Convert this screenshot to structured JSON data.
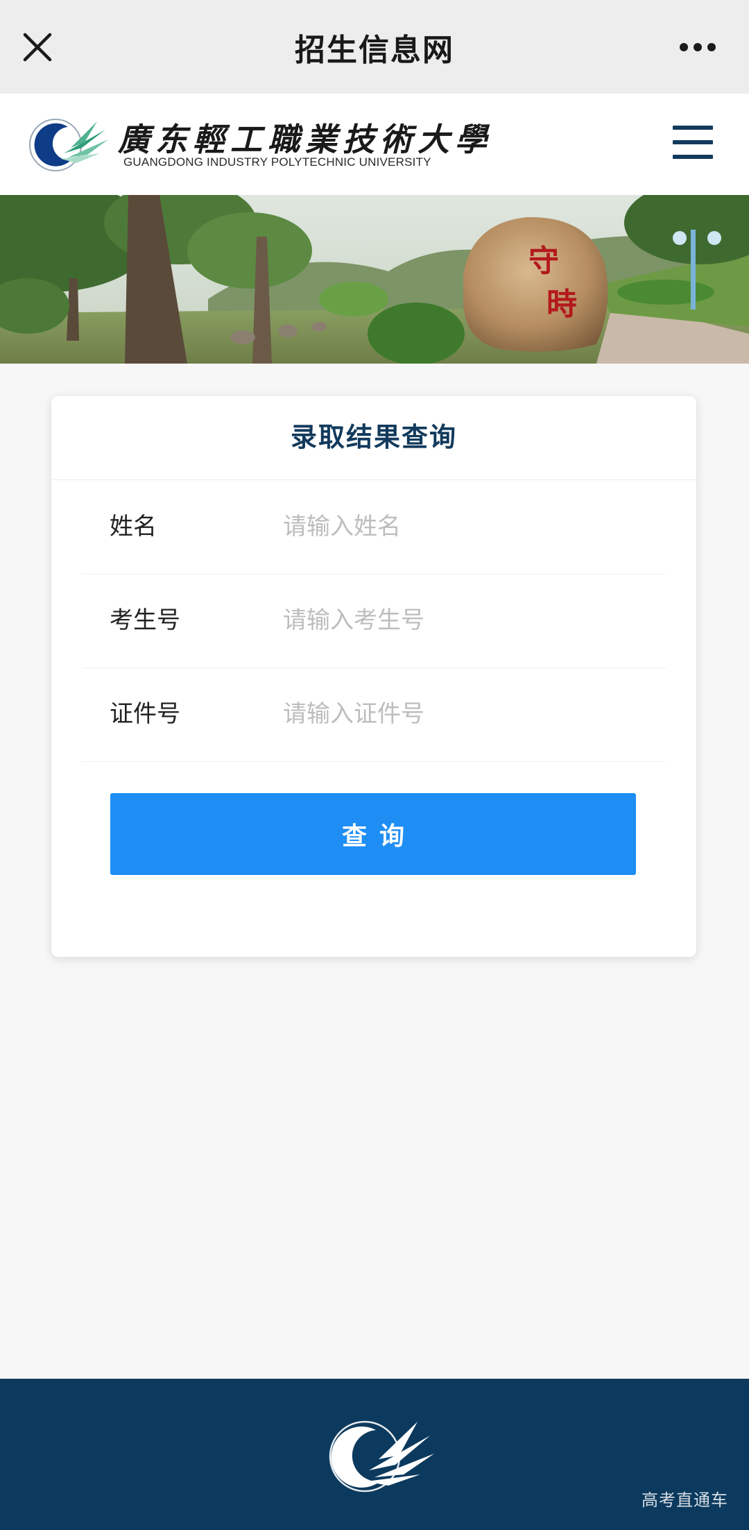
{
  "topbar": {
    "title": "招生信息网",
    "close_icon": "close-icon",
    "more_icon": "more-icon"
  },
  "header": {
    "school_name_cn": "廣东輕工職業技術大學",
    "school_name_en": "GUANGDONG INDUSTRY POLYTECHNIC UNIVERSITY",
    "menu_icon": "hamburger-menu-icon"
  },
  "banner": {
    "stone_inscription": "守時"
  },
  "query_form": {
    "title": "录取结果查询",
    "fields": [
      {
        "label": "姓名",
        "placeholder": "请输入姓名",
        "value": ""
      },
      {
        "label": "考生号",
        "placeholder": "请输入考生号",
        "value": ""
      },
      {
        "label": "证件号",
        "placeholder": "请输入证件号",
        "value": ""
      }
    ],
    "submit_label": "查询"
  },
  "footer": {
    "watermark": "高考直通车"
  },
  "colors": {
    "brand_navy": "#0c3a5e",
    "title_navy": "#123a5c",
    "button_blue": "#1e8ef5",
    "page_bg": "#f7f7f7"
  }
}
